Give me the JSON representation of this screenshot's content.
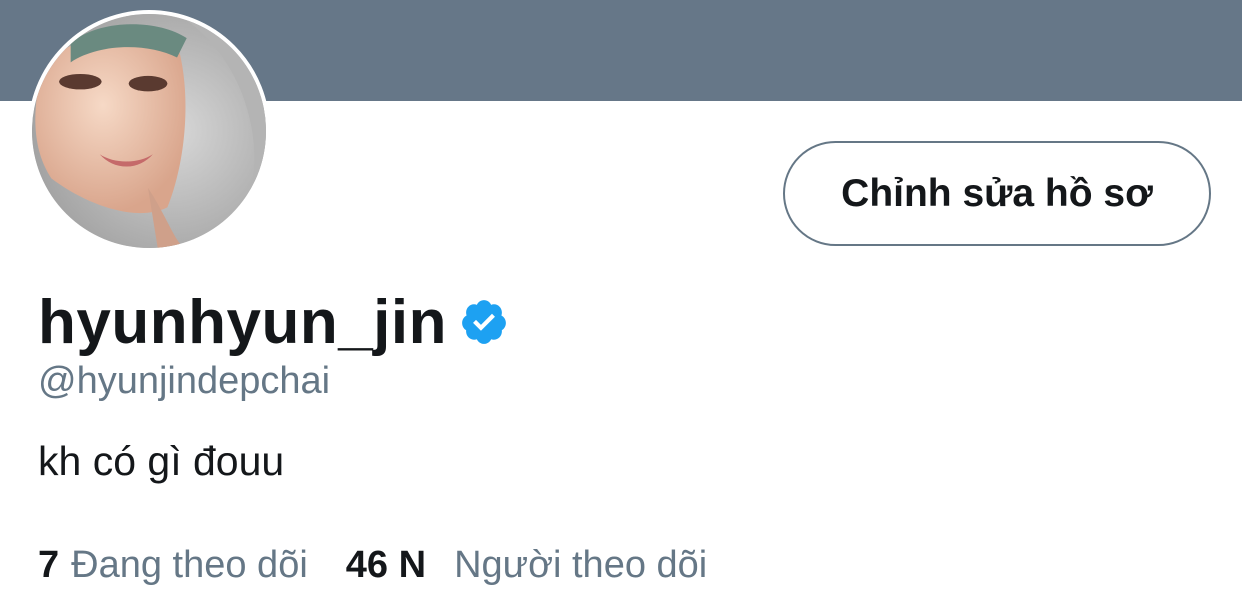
{
  "profile": {
    "display_name": "hyunhyun_jin",
    "handle": "@hyunjindepchai",
    "bio": "kh có gì đouu",
    "verified": true,
    "edit_button_label": "Chỉnh sửa hồ sơ"
  },
  "stats": {
    "following_count": "7",
    "following_label": "Đang theo dõi",
    "followers_count": "46 N",
    "followers_label": "Người theo dõi"
  },
  "colors": {
    "banner": "#667788",
    "verified_badge": "#1da1f2",
    "secondary_text": "#657786",
    "primary_text": "#14171a"
  },
  "icons": {
    "verified": "verified-badge-icon"
  }
}
